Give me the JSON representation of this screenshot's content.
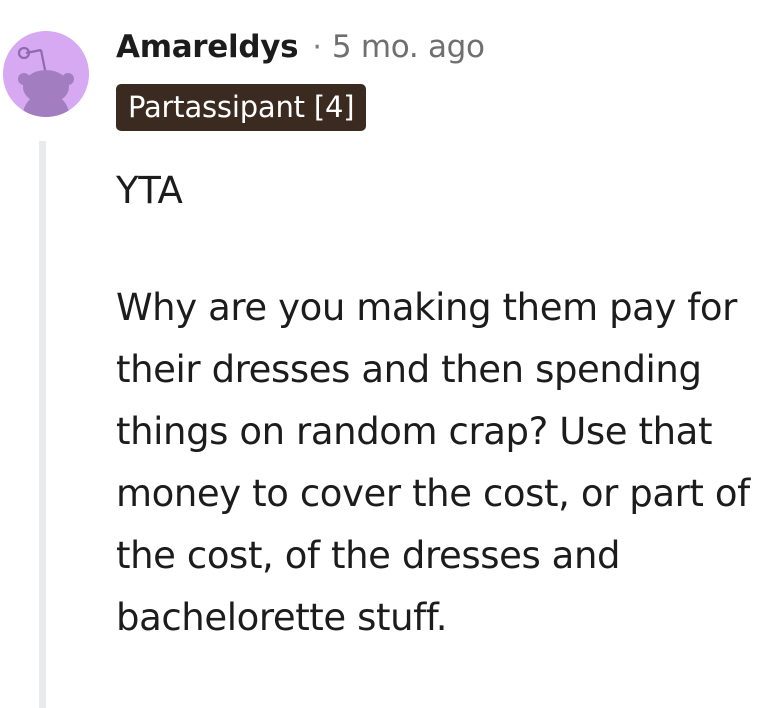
{
  "comment": {
    "username": "Amareldys",
    "separator": "·",
    "timestamp": "5 mo. ago",
    "flair": "Partassipant [4]",
    "paragraphs": [
      "YTA",
      "Why are you making them pay for their dresses and then spending things on random crap? Use that money to cover the cost, or part of the cost, of the dresses and bachelorette stuff."
    ]
  },
  "colors": {
    "avatar_background": "#d6a9f2",
    "avatar_snoo": "#a27ec1",
    "flair_background": "#3b2a20",
    "thread_line": "#e9eaeb",
    "meta_text": "#6f6f6f"
  },
  "icons": {
    "avatar": "snoo-avatar-icon"
  }
}
